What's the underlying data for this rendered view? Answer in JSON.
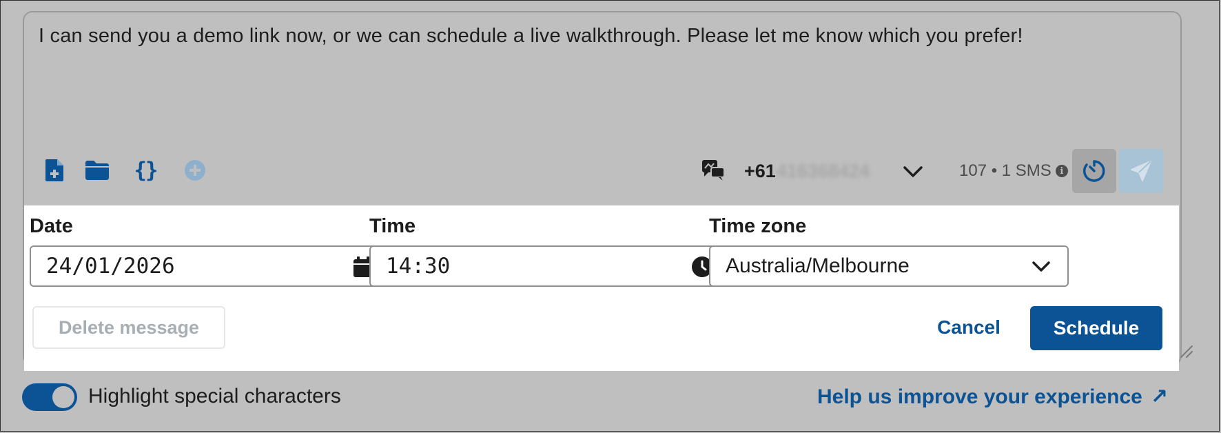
{
  "message": {
    "text": "I can send you a demo link now, or we can schedule a live walkthrough. Please let me know which you prefer!"
  },
  "toolbar": {
    "icons": [
      "new-document-icon",
      "folder-icon",
      "variables-braces-icon",
      "add-circle-icon"
    ],
    "braces_glyph": "{}",
    "sender_icon": "conversation-icon",
    "phone_prefix": "+61",
    "phone_rest": "416368424",
    "char_count": "107 • 1 SMS",
    "info_glyph": "i",
    "schedule_icon": "timer-icon",
    "send_icon": "send-plane-icon"
  },
  "schedule": {
    "date_label": "Date",
    "date_value": "24/01/2026",
    "time_label": "Time",
    "time_value": "14:30",
    "timezone_label": "Time zone",
    "timezone_value": "Australia/Melbourne",
    "delete_label": "Delete message",
    "cancel_label": "Cancel",
    "schedule_label": "Schedule"
  },
  "footer": {
    "highlight_label": "Highlight special characters",
    "highlight_on": true,
    "help_link": "Help us improve your experience",
    "help_arrow": "↗"
  },
  "colors": {
    "brand": "#0b5394",
    "background_dim": "#bfbfbf",
    "panel": "#ffffff",
    "send_disabled": "#a8c2d6"
  }
}
